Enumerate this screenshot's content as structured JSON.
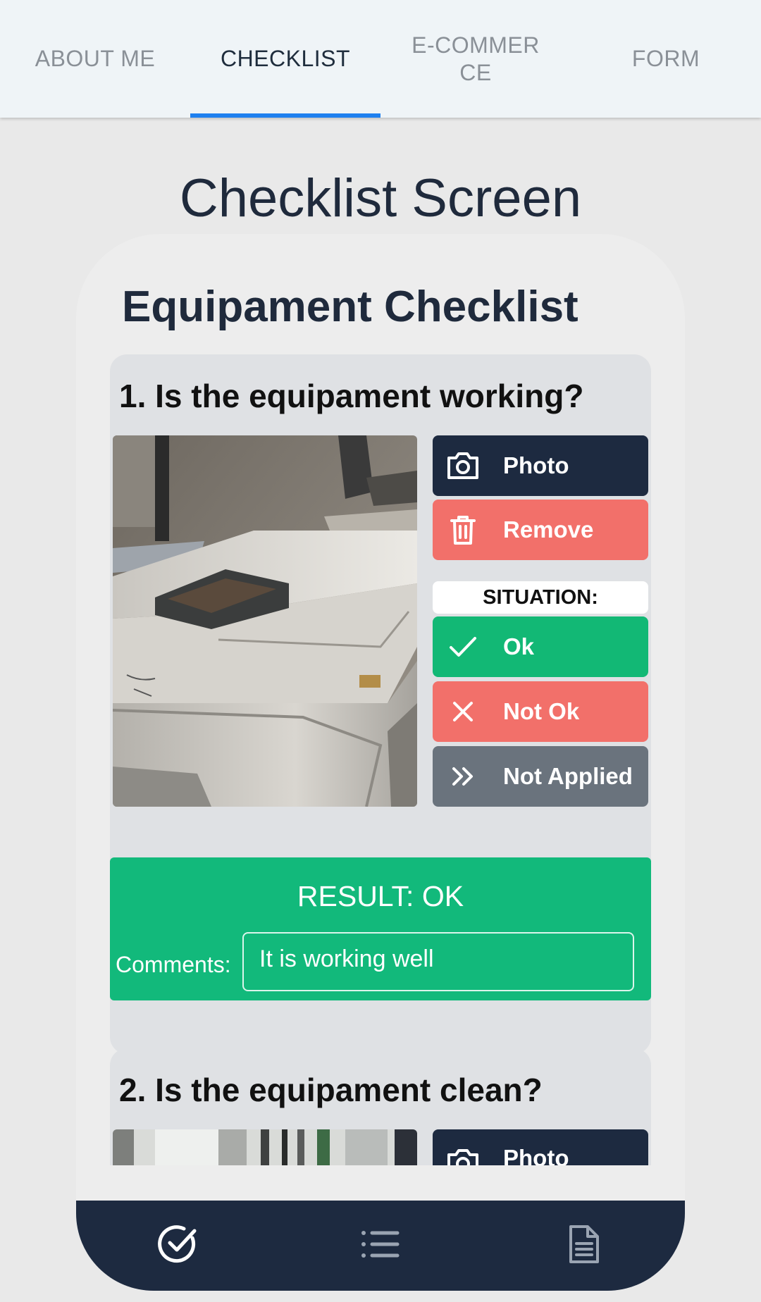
{
  "tabs": [
    {
      "label": "ABOUT ME",
      "active": false
    },
    {
      "label": "CHECKLIST",
      "active": true
    },
    {
      "label": "E-COMMERCE",
      "active": false
    },
    {
      "label": "FORM",
      "active": false
    }
  ],
  "screen_title": "Checklist Screen",
  "checklist": {
    "title": "Equipament Checklist",
    "items": [
      {
        "question": "1. Is the equipament working?",
        "photo_label": "Photo",
        "remove_label": "Remove",
        "situation_label": "SITUATION:",
        "ok_label": "Ok",
        "not_ok_label": "Not Ok",
        "not_applied_label": "Not Applied",
        "result": "RESULT: OK",
        "comments_label": "Comments:",
        "comments_value": "It is working well"
      },
      {
        "question": "2. Is the equipament clean?",
        "photo_label": "Photo"
      }
    ]
  },
  "bottom_nav": {
    "icons": [
      "check-circle-icon",
      "list-icon",
      "document-icon"
    ]
  },
  "colors": {
    "navy": "#1d2a40",
    "red": "#f2706a",
    "green": "#12b875",
    "gray": "#6a737d",
    "tab_indicator": "#1e80ef"
  }
}
